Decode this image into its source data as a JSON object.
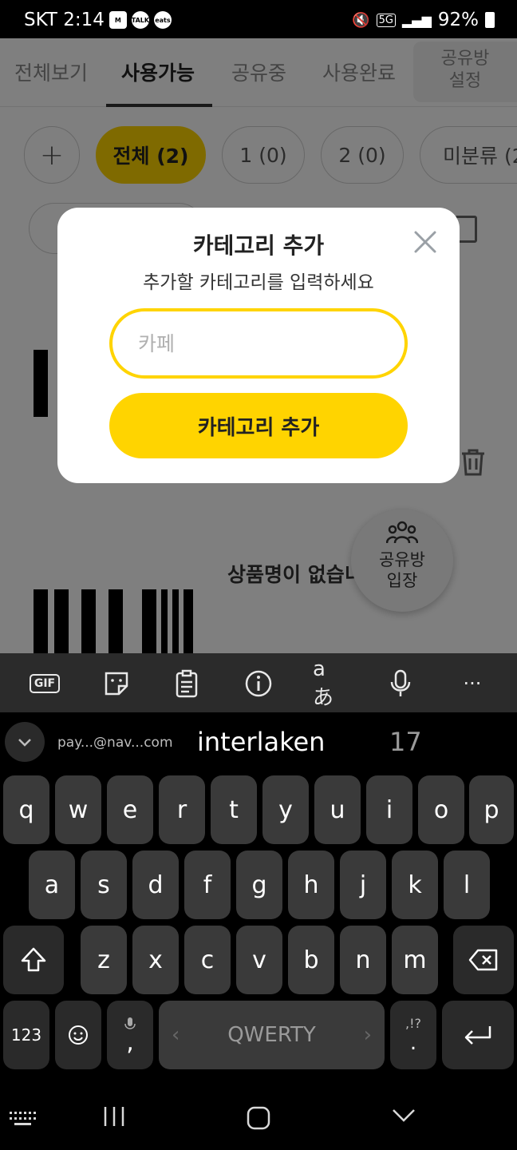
{
  "status_bar": {
    "carrier_time": "SKT 2:14",
    "notif_icons": [
      "lock-m",
      "talk",
      "eats"
    ],
    "network": "5G",
    "battery": "92%"
  },
  "tabs": [
    {
      "label": "전체보기",
      "active": false
    },
    {
      "label": "사용가능",
      "active": true
    },
    {
      "label": "공유중",
      "active": false
    },
    {
      "label": "사용완료",
      "active": false
    }
  ],
  "share_settings": {
    "line1": "공유방",
    "line2": "설정"
  },
  "chips": [
    {
      "label": "+",
      "active": false
    },
    {
      "label": "전체 (2)",
      "active": true
    },
    {
      "label": "1 (0)",
      "active": false
    },
    {
      "label": "2 (0)",
      "active": false
    },
    {
      "label": "미분류 (2",
      "active": false
    }
  ],
  "product_name": "상품명이 없습니",
  "fab": {
    "line1": "공유방",
    "line2": "입장"
  },
  "dialog": {
    "title": "카테고리 추가",
    "subtitle": "추가할 카테고리를 입력하세요",
    "input_value": "",
    "input_placeholder": "카페",
    "button_label": "카테고리 추가"
  },
  "keyboard": {
    "toolbar": [
      "GIF",
      "sticker",
      "clipboard",
      "info",
      "translate",
      "mic",
      "more"
    ],
    "suggestions": {
      "email": "pay...@nav...com",
      "main": "interlaken",
      "number": "17"
    },
    "row1": [
      "q",
      "w",
      "e",
      "r",
      "t",
      "y",
      "u",
      "i",
      "o",
      "p"
    ],
    "row2": [
      "a",
      "s",
      "d",
      "f",
      "g",
      "h",
      "j",
      "k",
      "l"
    ],
    "row3": [
      "z",
      "x",
      "c",
      "v",
      "b",
      "n",
      "m"
    ],
    "num_key": "123",
    "comma_key": ",",
    "space_label": "QWERTY",
    "punct_top": ",!?",
    "punct_bottom": "."
  }
}
